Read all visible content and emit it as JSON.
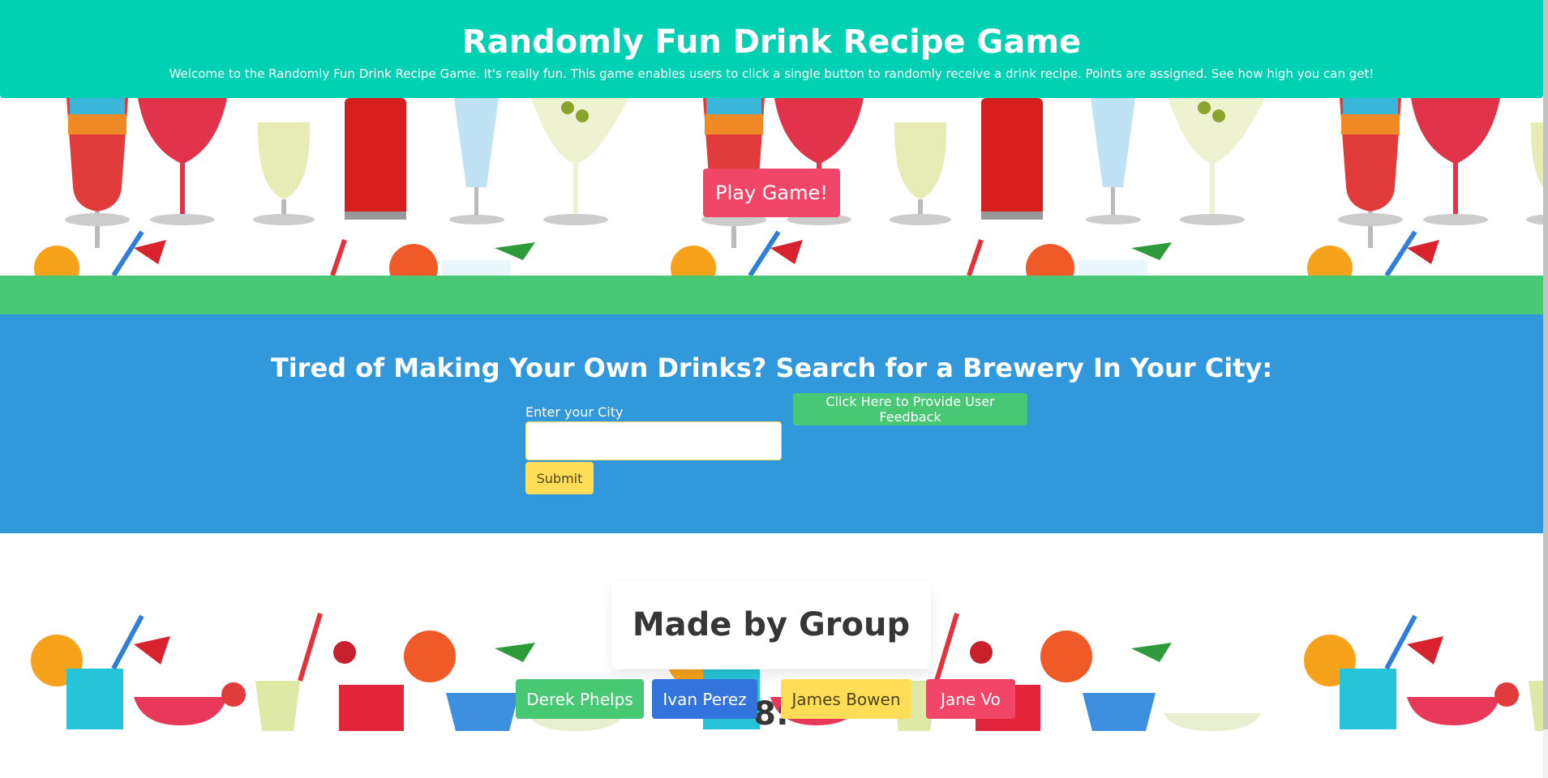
{
  "header": {
    "title": "Randomly Fun Drink Recipe Game",
    "subtitle": "Welcome to the Randomly Fun Drink Recipe Game. It's really fun. This game enables users to click a single button to randomly receive a drink recipe. Points are assigned. See how high you can get!"
  },
  "game": {
    "play_label": "Play Game!"
  },
  "brewery": {
    "heading": "Tired of Making Your Own Drinks? Search for a Brewery In Your City:",
    "city_label": "Enter your City",
    "city_value": "",
    "submit_label": "Submit",
    "feedback_label": "Click Here to Provide User Feedback"
  },
  "credits": {
    "heading": "Made by Group 8:",
    "members": [
      "Derek Phelps",
      "Ivan Perez",
      "James Bowen",
      "Jane Vo"
    ]
  },
  "colors": {
    "header": "#00d1b2",
    "danger": "#f14668",
    "success": "#48c774",
    "info": "#3298dc",
    "link": "#3273dc",
    "warning": "#ffdd57"
  }
}
